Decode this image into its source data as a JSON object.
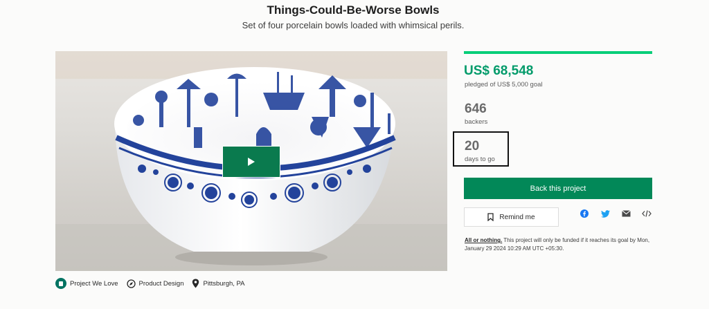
{
  "project": {
    "title": "Things-Could-Be-Worse Bowls",
    "subtitle": "Set of four porcelain bowls loaded with whimsical perils."
  },
  "media": {
    "play_icon": "play-icon"
  },
  "tags": [
    {
      "label": "Project We Love",
      "icon": "kickstarter-badge-icon"
    },
    {
      "label": "Product Design",
      "icon": "compass-icon"
    },
    {
      "label": "Pittsburgh, PA",
      "icon": "location-pin-icon"
    }
  ],
  "stats": {
    "pledged": "US$ 68,548",
    "pledged_label": "pledged of US$ 5,000 goal",
    "backers": "646",
    "backers_label": "backers",
    "days": "20",
    "days_label": "days to go",
    "funded_fraction": 1.0
  },
  "actions": {
    "back_label": "Back this project",
    "remind_label": "Remind me",
    "remind_icon": "bookmark-icon",
    "share_icons": [
      "facebook-icon",
      "twitter-icon",
      "email-icon",
      "embed-icon"
    ]
  },
  "funding_note": {
    "link": "All or nothing.",
    "text": " This project will only be funded if it reaches its goal by Mon, January 29 2024 10:29 AM UTC +05:30."
  },
  "colors": {
    "brand_green": "#028858",
    "pledged_green": "#029b6a",
    "progress_green": "#05ce78",
    "facebook_blue": "#1877f2",
    "twitter_blue": "#1da1f2",
    "bowl_blue": "#23439b"
  }
}
